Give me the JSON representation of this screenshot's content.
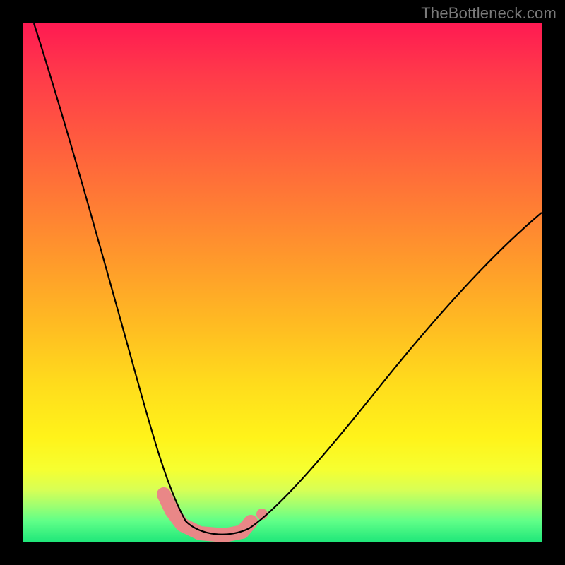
{
  "watermark": "TheBottleneck.com",
  "chart_data": {
    "type": "line",
    "title": "",
    "xlabel": "",
    "ylabel": "",
    "xlim": [
      0,
      100
    ],
    "ylim": [
      0,
      100
    ],
    "note": "Bottleneck curve. Y-axis peaks near 100 at x=0, drops to a broad minimum near 0 around x≈30–40, then rises toward ~55 at x=100. Background color encodes severity (red high, green low).",
    "series": [
      {
        "name": "bottleneck-curve",
        "x": [
          0,
          5,
          10,
          15,
          20,
          25,
          30,
          35,
          38,
          42,
          50,
          60,
          70,
          80,
          90,
          100
        ],
        "values": [
          100,
          85,
          68,
          50,
          32,
          15,
          4,
          1,
          0,
          1,
          6,
          16,
          27,
          37,
          47,
          55
        ]
      }
    ],
    "highlight": {
      "name": "highlighted-range",
      "x": [
        27,
        30,
        33,
        36,
        39,
        42,
        44
      ],
      "values": [
        8,
        4,
        1.5,
        0.5,
        0.5,
        1.5,
        3
      ]
    },
    "background_gradient_stops": [
      {
        "pct": 0,
        "color": "#ff1a52"
      },
      {
        "pct": 50,
        "color": "#ffbb22"
      },
      {
        "pct": 85,
        "color": "#fff31a"
      },
      {
        "pct": 100,
        "color": "#20e77a"
      }
    ]
  }
}
